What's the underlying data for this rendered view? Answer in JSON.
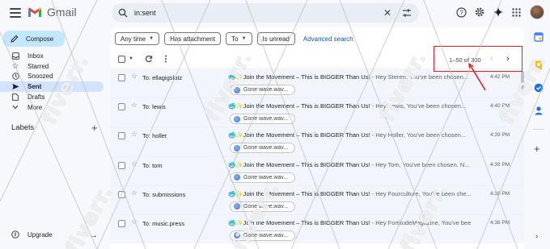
{
  "app": {
    "logo_text": "Gmail"
  },
  "search": {
    "query": "in:sent",
    "clear_glyph": "✕"
  },
  "nav": {
    "compose_label": "Compose",
    "items": [
      {
        "label": "Inbox",
        "icon": "inbox-icon"
      },
      {
        "label": "Starred",
        "icon": "star-icon"
      },
      {
        "label": "Snoozed",
        "icon": "clock-icon"
      },
      {
        "label": "Sent",
        "icon": "send-icon",
        "active": true
      },
      {
        "label": "Drafts",
        "icon": "draft-icon"
      },
      {
        "label": "More",
        "icon": "chevron-down-icon"
      }
    ],
    "labels_heading": "Labels",
    "upgrade_label": "Upgrade"
  },
  "filters": {
    "any_time": "Any time",
    "has_attachment": "Has attachment",
    "to": "To",
    "is_unread": "Is unread",
    "advanced_search": "Advanced search"
  },
  "pager": {
    "text": "1–50 of 300"
  },
  "emails": [
    {
      "to": "To: ellagigslutz",
      "subject": "Join the Movement – This is BIGGER Than Us!",
      "snippet": " - Hey Steren, You've been chosen...",
      "time": "4:42 PM",
      "attachment": "Gone wave.wav..."
    },
    {
      "to": "To: lewis",
      "subject": "Join the Movement – This is BIGGER Than Us!",
      "snippet": " - Hey Lewis, You've been chosen...",
      "time": "4:40 PM",
      "attachment": "Gone wave.wav..."
    },
    {
      "to": "To: holler",
      "subject": "Join the Movement – This is BIGGER Than Us!",
      "snippet": " - Hey Holler, You've been chosen...",
      "time": "4:39 PM",
      "attachment": "Gone wave.wav..."
    },
    {
      "to": "To: tom",
      "subject": "Join the Movement – This is BIGGER Than Us!",
      "snippet": " - Hey Tom, You've been chosen. N...",
      "time": "4:39 PM",
      "attachment": "Gone wave.wav..."
    },
    {
      "to": "To: submissions",
      "subject": "Join the Movement – This is BIGGER Than Us!",
      "snippet": " - Hey Fourculture, You've been che...",
      "time": "4:38 PM",
      "attachment": "Gone wave.wav..."
    },
    {
      "to": "To: music.press",
      "subject": "Join the Movement – This is BIGGER Than Us!",
      "snippet": " - Hey FortitudeMagazine, You've been c...",
      "time": "4:38 PM",
      "attachment": "Gone wave.wav..."
    }
  ],
  "subject_prefix": "🥶✨",
  "colors": {
    "compose_bg": "#c2e7ff",
    "active_nav_bg": "#d3e3fd",
    "link_blue": "#0b57d0",
    "annotation_red": "#e02020"
  },
  "watermark": "fiverr."
}
